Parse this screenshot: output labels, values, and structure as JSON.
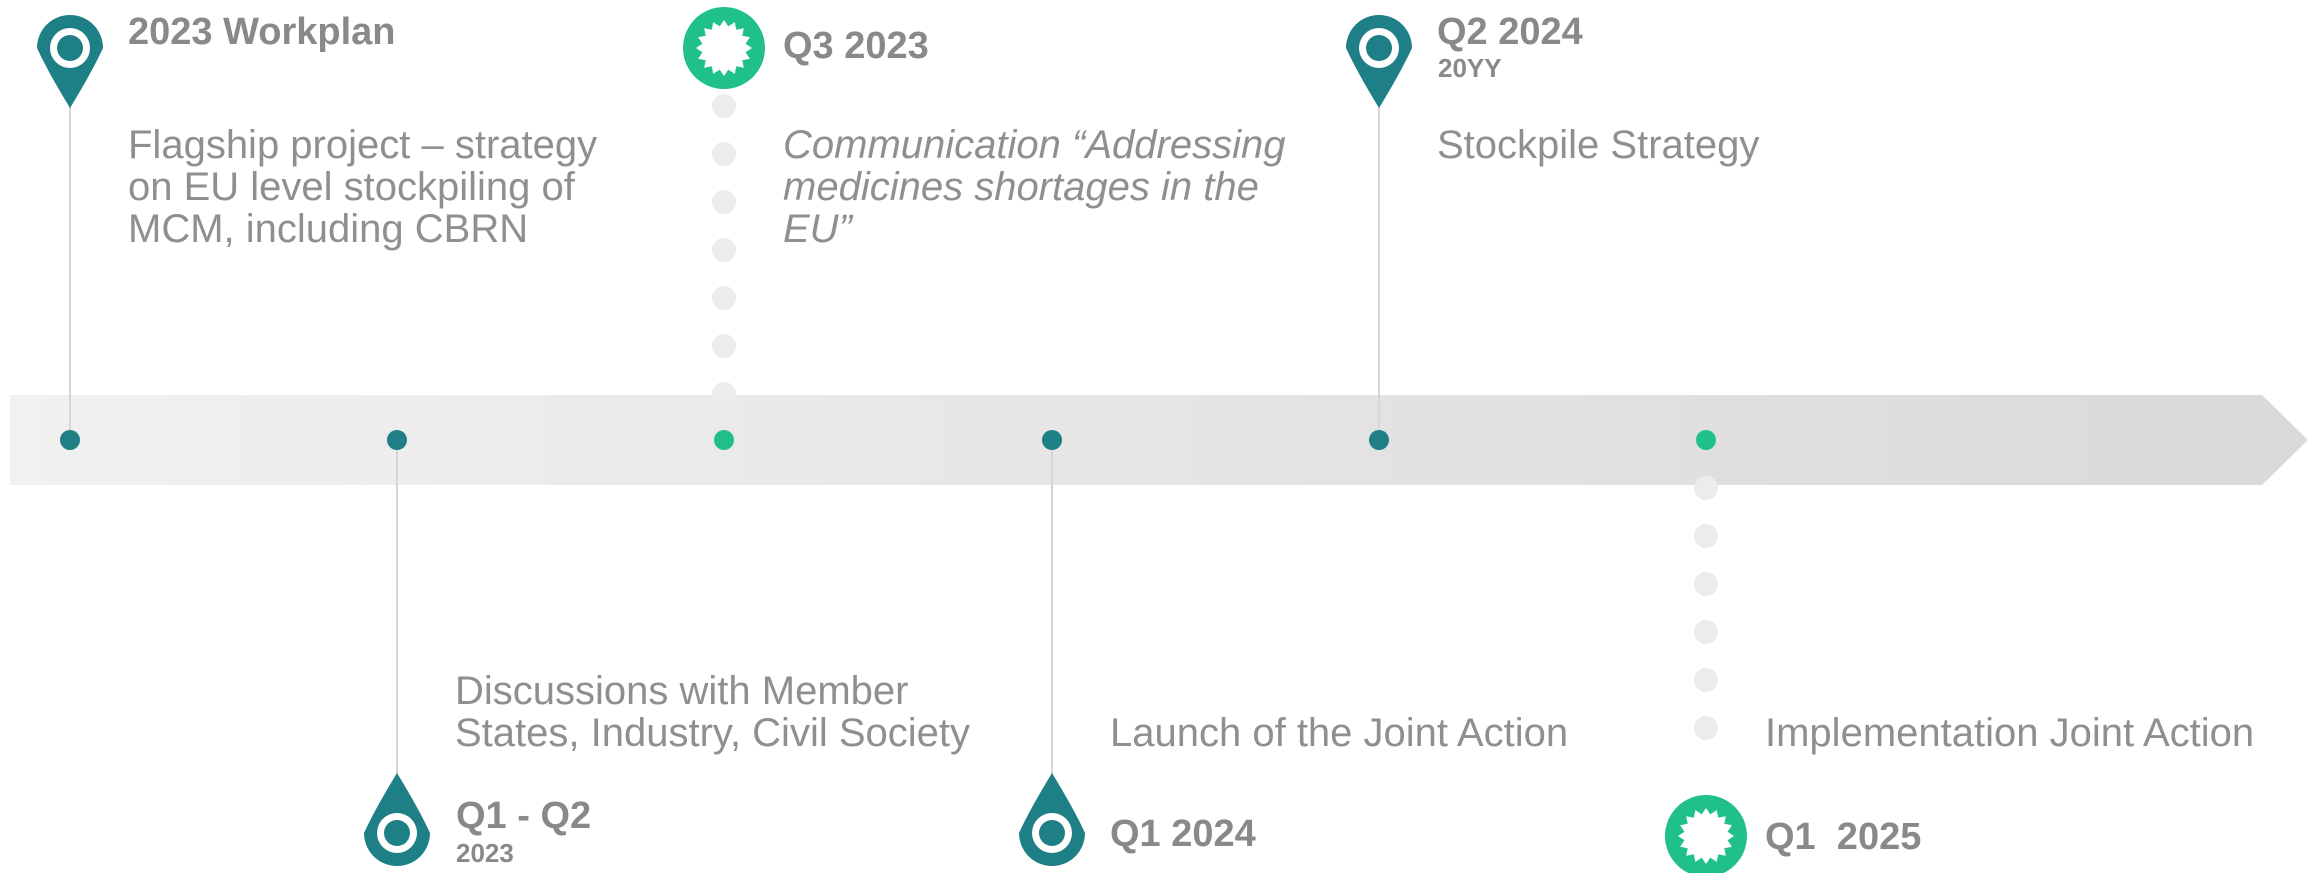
{
  "colors": {
    "teal": "#1f7f86",
    "green": "#1fc08a",
    "arrow_light": "#f1f1f1",
    "arrow_dark": "#d9d9d9",
    "stem": "#d6d6d6",
    "dots": "#ececec",
    "text": "#8c8c8c"
  },
  "milestones": [
    {
      "title": "2023 Workplan",
      "subtitle": "",
      "description": "Flagship project – strategy on EU level stockpiling of MCM, including CBRN",
      "italic": false,
      "marker": "map-pin-icon",
      "color": "teal",
      "side": "above"
    },
    {
      "title": "Q1 - Q2",
      "subtitle": "2023",
      "description": "Discussions with Member States, Industry, Civil Society",
      "italic": false,
      "marker": "map-pin-icon",
      "color": "teal",
      "side": "below"
    },
    {
      "title": "Q3 2023",
      "subtitle": "",
      "description": "Communication “Addressing medicines shortages in the EU”",
      "italic": true,
      "marker": "starburst-icon",
      "color": "green",
      "side": "above"
    },
    {
      "title": "Q1 2024",
      "subtitle": "",
      "description": "Launch of the Joint Action",
      "italic": false,
      "marker": "map-pin-icon",
      "color": "teal",
      "side": "below"
    },
    {
      "title": "Q2 2024",
      "subtitle": "20YY",
      "description": "Stockpile Strategy",
      "italic": false,
      "marker": "map-pin-icon",
      "color": "teal",
      "side": "above"
    },
    {
      "title": "Q1  2025",
      "subtitle": "",
      "description": "Implementation Joint Action",
      "italic": false,
      "marker": "starburst-icon",
      "color": "green",
      "side": "below"
    }
  ]
}
